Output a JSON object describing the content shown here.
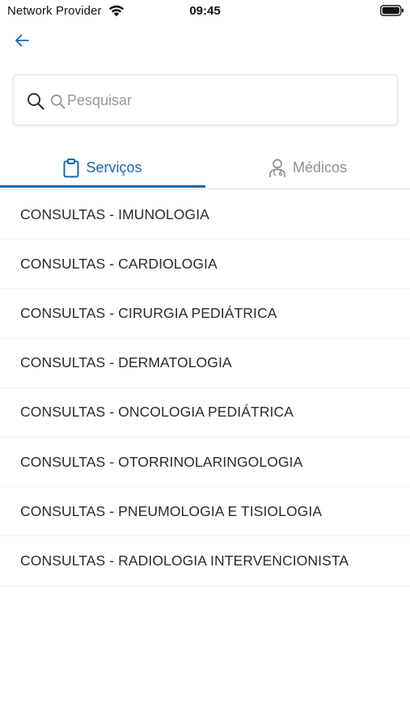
{
  "status_bar": {
    "carrier": "Network Provider",
    "time": "09:45"
  },
  "search": {
    "placeholder": "Pesquisar"
  },
  "tabs": [
    {
      "label": "Serviços",
      "icon": "clipboard-icon",
      "active": true
    },
    {
      "label": "Médicos",
      "icon": "doctor-icon",
      "active": false
    }
  ],
  "services": [
    {
      "label": "CONSULTAS - IMUNOLOGIA"
    },
    {
      "label": "CONSULTAS - CARDIOLOGIA"
    },
    {
      "label": "CONSULTAS - CIRURGIA PEDIÁTRICA"
    },
    {
      "label": "CONSULTAS - DERMATOLOGIA"
    },
    {
      "label": "CONSULTAS - ONCOLOGIA PEDIÁTRICA"
    },
    {
      "label": "CONSULTAS - OTORRINOLARINGOLOGIA"
    },
    {
      "label": "CONSULTAS - PNEUMOLOGIA E TISIOLOGIA"
    },
    {
      "label": "CONSULTAS - RADIOLOGIA INTERVENCIONISTA"
    }
  ],
  "colors": {
    "accent": "#1768b0",
    "inactive_tab": "#8f8f8f",
    "text": "#2b2b2b"
  }
}
